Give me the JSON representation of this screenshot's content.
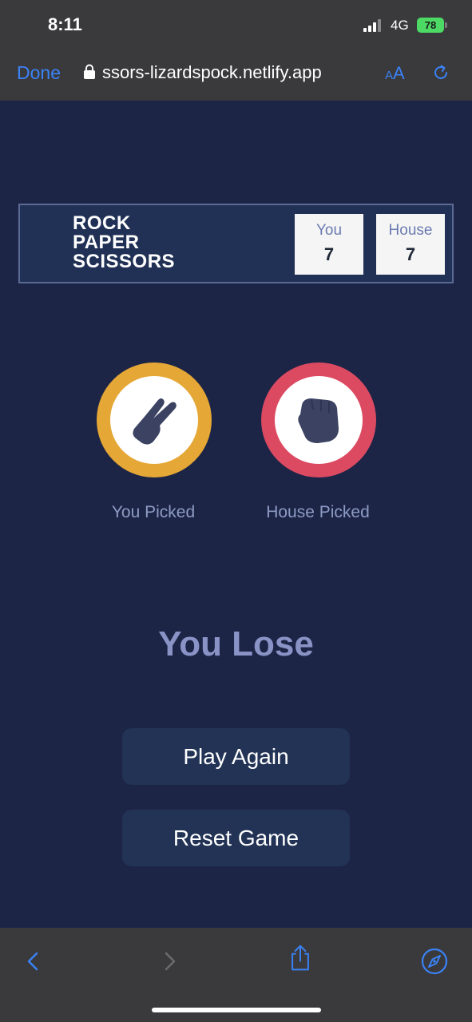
{
  "status_bar": {
    "time": "8:11",
    "network": "4G",
    "battery": "78"
  },
  "browser": {
    "done_label": "Done",
    "url": "ssors-lizardspock.netlify.app",
    "text_size_label_small": "A",
    "text_size_label_large": "A",
    "accent_color": "#3b82f6"
  },
  "game": {
    "logo_lines": [
      "ROCK",
      "PAPER",
      "SCISSORS"
    ],
    "scores": {
      "you_label": "You",
      "you_value": "7",
      "house_label": "House",
      "house_value": "7"
    },
    "you_pick": {
      "label": "You Picked",
      "icon": "scissors-hand-icon",
      "ring_color": "#e5a736"
    },
    "house_pick": {
      "label": "House Picked",
      "icon": "rock-fist-icon",
      "ring_color": "#dc4a62"
    },
    "result": "You Lose",
    "play_again_label": "Play Again",
    "reset_label": "Reset Game"
  },
  "toolbar": {
    "icons": [
      "back-icon",
      "forward-icon",
      "share-icon",
      "safari-compass-icon"
    ]
  }
}
